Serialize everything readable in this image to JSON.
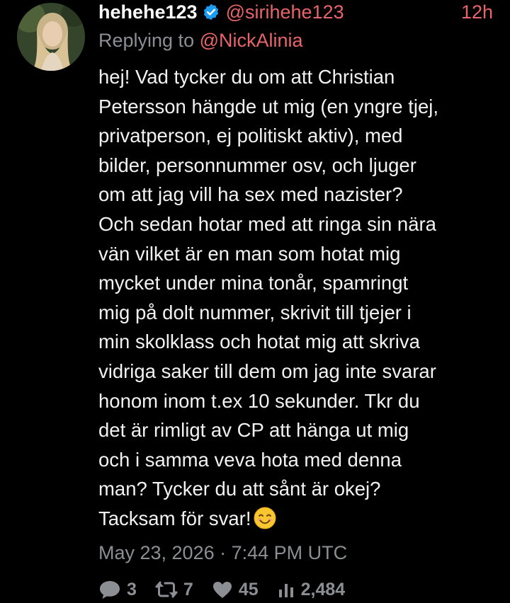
{
  "tweet": {
    "display_name": "hehehe123",
    "handle": "@sirihehe123",
    "time_ago": "12h",
    "replying_prefix": "Replying to",
    "replying_handle": "@NickAlinia",
    "body": "hej! Vad tycker du om att Christian\nPetersson hängde ut mig (en yngre tjej,\nprivatperson, ej politiskt aktiv), med\nbilder, personnummer osv, och ljuger\nom att jag vill ha sex med nazister?\nOch sedan hotar med att ringa sin nära\nvän vilket är en man som hotat mig\nmycket under mina tonår, spamringt\nmig på dolt nummer, skrivit till tjejer i\nmin skolklass och hotat mig att skriva\nvidriga saker till dem om jag inte svarar\nhonom inom t.ex 10 sekunder. Tkr du\ndet är rimligt av CP att hänga ut mig\noch i samma veva hota med denna\nman? Tycker du att sånt är okej?\nTacksam för svar!",
    "body_emoji": "smiling-face-emoji",
    "timestamp": "May 23, 2026 · 7:44 PM UTC",
    "verified_icon": "verified-badge-icon"
  },
  "stats": {
    "replies": "3",
    "retweets": "7",
    "likes": "45",
    "views": "2,484"
  },
  "colors": {
    "background": "#000000",
    "accent": "#e8646a",
    "muted": "#8b8f94",
    "text": "#f2f2f2",
    "verified": "#1d9bf0"
  }
}
